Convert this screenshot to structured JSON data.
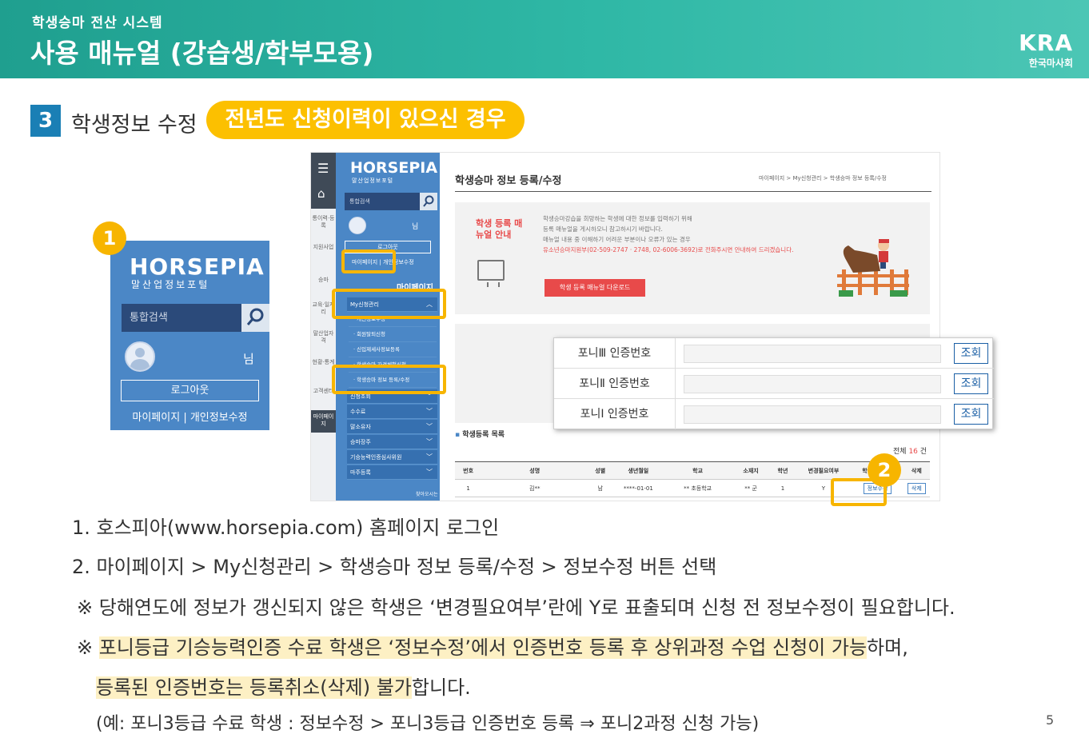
{
  "header": {
    "subtitle": "학생승마 전산 시스템",
    "title": "사용 매뉴얼 (강습생/학부모용)",
    "logo_mark": "KRA",
    "logo_text": "한국마사회"
  },
  "section": {
    "number": "3",
    "title": "학생정보 수정",
    "tag": "전년도 신청이력이 있으신 경우"
  },
  "badges": [
    "1",
    "2"
  ],
  "login_widget": {
    "logo": "HORSEPIA",
    "logo_sub": "말산업정보포털",
    "search_placeholder": "통합검색",
    "user_suffix": "님",
    "logout": "로그아웃",
    "links": "마이페이지 | 개인정보수정"
  },
  "screenshot": {
    "rail": [
      "통이력·등록",
      "지원사업",
      "승마",
      "교육·일자리",
      "말산업자격",
      "현황·통계",
      "고객센터",
      "마이페이지"
    ],
    "sidebar": {
      "logo": "HORSEPIA",
      "logo_sub": "말산업정보포털",
      "search_placeholder": "통합검색",
      "user_suffix": "님",
      "logout": "로그아웃",
      "links": "마이페이지 | 개인정보수정",
      "mypage_title": "마이페이지",
      "menu_open": "My신청관리",
      "submenu": [
        "· 개인정보수정",
        "· 회원탈퇴신청",
        "· 신입제세사정보등록",
        "· 학생승마 자격체험신청",
        "· 학생승마 정보 등록/수정"
      ],
      "menus": [
        "신청조회",
        "수수료",
        "말소유자",
        "승마장주",
        "기승능력인증심사위원",
        "마주등록"
      ],
      "footer": "찾아오시는 길"
    },
    "page_title": "학생승마 정보 등록/수정",
    "breadcrumb": "마이페이지 > My신청관리 > 학생승마 정보 등록/수정",
    "guide": {
      "label": "학생 등록 매뉴얼 안내",
      "lines": [
        "학생승마강습을 희망하는 학생에 대한 정보를 입력하기 위해",
        "등록 매뉴얼을 게시하오니 참고하시기 바랍니다.",
        "매뉴얼 내용 중 이해하기 어려운 부분이나 오류가 있는 경우",
        "유소년승마지원부(02-509-2747 · 2748, 02-6006-3692)로 전화주시면 안내하여 드리겠습니다."
      ],
      "download": "학생 등록 매뉴얼 다운로드"
    },
    "list_title": "학생등록 목록",
    "total_label": "전체",
    "total_count": "16",
    "total_unit": "건",
    "columns": [
      "번호",
      "성명",
      "성별",
      "생년월일",
      "학교",
      "소재지",
      "학년",
      "변경필요여부",
      "학생정보수정",
      "삭제"
    ],
    "rows": [
      [
        "1",
        "김**",
        "남",
        "****-01-01",
        "** 초등학교",
        "** 군",
        "1",
        "Y",
        "정보수정",
        "삭제"
      ]
    ]
  },
  "popup": {
    "rows": [
      {
        "label": "포니Ⅲ 인증번호",
        "button": "조회"
      },
      {
        "label": "포니Ⅱ 인증번호",
        "button": "조회"
      },
      {
        "label": "포니Ⅰ 인증번호",
        "button": "조회"
      }
    ]
  },
  "instructions": {
    "step1": "1. 호스피아(www.horsepia.com) 홈페이지 로그인",
    "step2": "2. 마이페이지 > My신청관리 > 학생승마 정보 등록/수정 > 정보수정 버튼 선택",
    "note1": "※ 당해연도에 정보가 갱신되지 않은 학생은 ‘변경필요여부’란에 Y로 표출되며 신청 전 정보수정이 필요합니다.",
    "note2_mark": "※",
    "note2_highlight": "포니등급 기승능력인증 수료 학생은 ‘정보수정’에서 인증번호 등록 후 상위과정 수업 신청이 가능",
    "note2_rest": "하며,",
    "note3_highlight": "등록된 인증번호는 등록취소(삭제) 불가",
    "note3_rest": "합니다.",
    "example": "(예: 포니3등급 수료 학생 : 정보수정 > 포니3등급 인증번호 등록 ⇒ 포니2과정 신청 가능)"
  },
  "page_number": "5"
}
